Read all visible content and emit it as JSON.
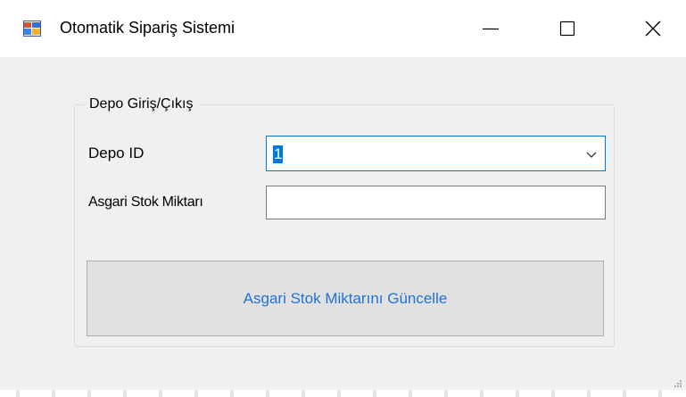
{
  "window": {
    "title": "Otomatik Sipariş Sistemi",
    "app_icon": "form-app-icon",
    "controls": {
      "minimize_icon": "minimize-icon",
      "maximize_icon": "maximize-icon",
      "close_icon": "close-icon"
    }
  },
  "group": {
    "legend": "Depo Giriş/Çıkış",
    "depo_id": {
      "label": "Depo ID",
      "selected_value": "1",
      "arrow_icon": "chevron-down-icon"
    },
    "asgari_stok": {
      "label": "Asgari Stok Miktarı",
      "value": ""
    },
    "update_button": {
      "label": "Asgari Stok Miktarını Güncelle"
    }
  },
  "colors": {
    "accent": "#0078d7",
    "button_text": "#1e73d8",
    "window_bg": "#f0f0f0",
    "titlebar_bg": "#ffffff"
  }
}
